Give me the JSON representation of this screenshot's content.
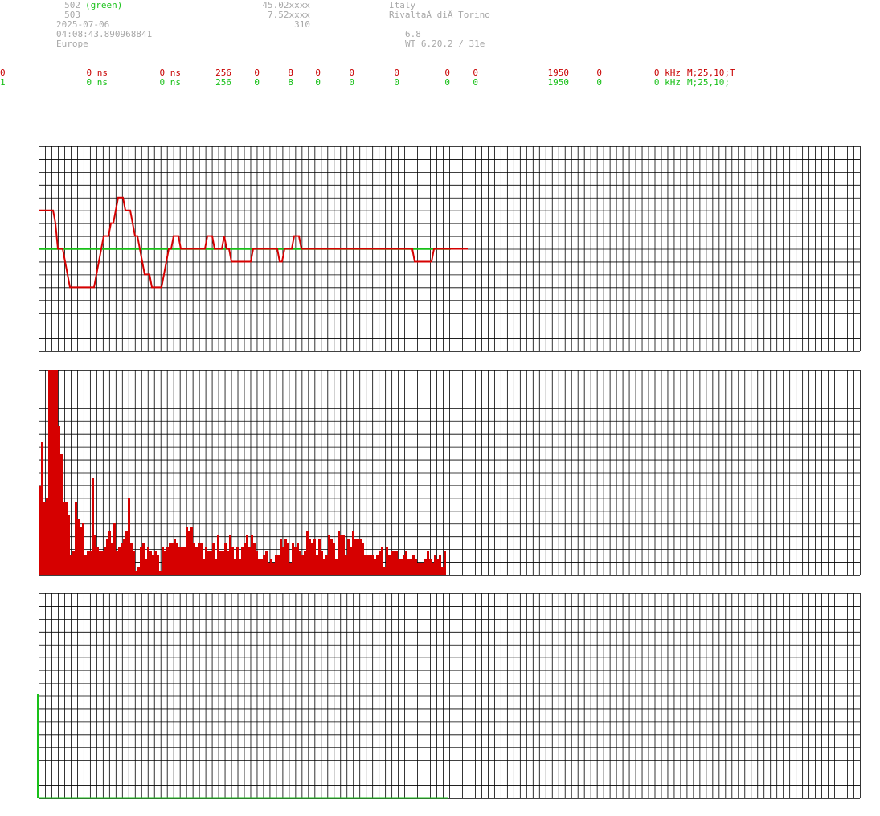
{
  "info": {
    "id1": "502",
    "id1_note": "(green)",
    "id2": "503",
    "date": "2025-07-06",
    "time": "04:08:43.890968841",
    "region": "Europe",
    "lat": "45.02xxxx",
    "lon": "7.52xxxx",
    "alt": "310",
    "country": "Italy",
    "city": "RivaltaÂ diÂ Torino",
    "val1": "6.8",
    "version": "WT 6.20.2 / 31e"
  },
  "rows": [
    {
      "ch": "0",
      "a": "0 ns",
      "b": "0 ns",
      "c": "256",
      "d": "0",
      "e": "8",
      "f": "0",
      "g": "0",
      "h": "0",
      "i": "0",
      "j": "0",
      "k": "1950",
      "l": "0",
      "m": "0 kHz",
      "n": "M;25,10;T",
      "color": "#c80000"
    },
    {
      "ch": "1",
      "a": "0 ns",
      "b": "0 ns",
      "c": "256",
      "d": "0",
      "e": "8",
      "f": "0",
      "g": "0",
      "h": "0",
      "i": "0",
      "j": "0",
      "k": "1950",
      "l": "0",
      "m": "0 kHz",
      "n": "M;25,10;",
      "color": "#18c018"
    }
  ],
  "colors": {
    "red": "#d60000",
    "green": "#18c018",
    "grid": "#000000"
  },
  "chart_data": [
    {
      "type": "line",
      "series": [
        {
          "color": "#d60000",
          "values": [
            3,
            3,
            3,
            3,
            3,
            3,
            3,
            2,
            0,
            0,
            0,
            -1,
            -2,
            -3,
            -3,
            -3,
            -3,
            -3,
            -3,
            -3,
            -3,
            -3,
            -3,
            -3,
            -2,
            -1,
            0,
            1,
            1,
            1,
            2,
            2,
            3,
            4,
            4,
            4,
            3,
            3,
            3,
            2,
            1,
            1,
            0,
            -1,
            -2,
            -2,
            -2,
            -3,
            -3,
            -3,
            -3,
            -3,
            -2,
            -1,
            0,
            0,
            1,
            1,
            1,
            0,
            0,
            0,
            0,
            0,
            0,
            0,
            0,
            0,
            0,
            0,
            1,
            1,
            1,
            0,
            0,
            0,
            0,
            1,
            0,
            0,
            -1,
            -1,
            -1,
            -1,
            -1,
            -1,
            -1,
            -1,
            -1,
            0,
            0,
            0,
            0,
            0,
            0,
            0,
            0,
            0,
            0,
            0,
            -1,
            -1,
            0,
            0,
            0,
            0,
            1,
            1,
            1,
            0,
            0,
            0,
            0,
            0,
            0,
            0,
            0,
            0,
            0,
            0,
            0,
            0,
            0,
            0,
            0,
            0,
            0,
            0,
            0,
            0,
            0,
            0,
            0,
            0,
            0,
            0,
            0,
            0,
            0,
            0,
            0,
            0,
            0,
            0,
            0,
            0,
            0,
            0,
            0,
            0,
            0,
            0,
            0,
            0,
            0,
            0,
            -1,
            -1,
            -1,
            -1,
            -1,
            -1,
            -1,
            -1,
            0,
            0,
            0,
            0,
            0,
            0,
            0,
            0,
            0,
            0,
            0,
            0,
            0,
            0,
            0
          ]
        },
        {
          "color": "#18c018",
          "values": [
            0,
            0,
            0,
            0,
            0,
            0,
            0,
            0,
            0,
            0,
            0,
            0,
            0,
            0,
            0,
            0,
            0,
            0,
            0,
            0,
            0,
            0,
            0,
            0,
            0,
            0,
            0,
            0,
            0,
            0,
            0,
            0,
            0,
            0,
            0,
            0,
            0,
            0,
            0,
            0,
            0,
            0,
            0,
            0,
            0,
            0,
            0,
            0,
            0,
            0,
            0,
            0,
            0,
            0,
            0,
            0,
            0,
            0,
            0,
            0,
            0,
            0,
            0,
            0,
            0,
            0,
            0,
            0,
            0,
            0,
            0,
            0,
            0,
            0,
            0,
            0,
            0,
            0,
            0,
            0,
            0,
            0,
            0,
            0,
            0,
            0,
            0,
            0,
            0,
            0,
            0,
            0,
            0,
            0,
            0,
            0,
            0,
            0,
            0,
            0,
            0,
            0,
            0,
            0,
            0,
            0,
            0,
            0,
            0,
            0,
            0,
            0,
            0,
            0,
            0,
            0,
            0,
            0,
            0,
            0,
            0,
            0,
            0,
            0,
            0,
            0,
            0,
            0,
            0,
            0,
            0,
            0,
            0,
            0,
            0,
            0,
            0,
            0,
            0,
            0,
            0,
            0,
            0,
            0,
            0,
            0,
            0,
            0,
            0,
            0,
            0,
            0,
            0,
            0,
            0,
            0,
            0,
            0,
            0,
            0,
            0,
            0,
            0,
            0,
            0,
            0,
            0,
            0,
            0,
            0,
            0,
            0
          ]
        }
      ],
      "ylim": [
        -8,
        8
      ],
      "grid": true
    },
    {
      "type": "bar",
      "series": [
        {
          "color": "#d60000",
          "values": [
            110,
            165,
            90,
            95,
            255,
            255,
            255,
            255,
            185,
            150,
            90,
            90,
            75,
            25,
            30,
            90,
            70,
            60,
            65,
            25,
            30,
            30,
            120,
            50,
            35,
            30,
            30,
            35,
            45,
            55,
            40,
            65,
            30,
            35,
            40,
            45,
            55,
            95,
            40,
            30,
            5,
            10,
            35,
            40,
            20,
            35,
            30,
            25,
            30,
            25,
            5,
            35,
            30,
            35,
            40,
            40,
            45,
            40,
            35,
            35,
            35,
            60,
            55,
            60,
            40,
            35,
            40,
            40,
            20,
            35,
            30,
            30,
            40,
            20,
            50,
            30,
            30,
            40,
            30,
            50,
            35,
            20,
            35,
            20,
            35,
            40,
            50,
            35,
            50,
            40,
            30,
            20,
            20,
            25,
            30,
            15,
            20,
            15,
            25,
            25,
            45,
            35,
            45,
            40,
            15,
            40,
            35,
            40,
            30,
            25,
            30,
            55,
            45,
            40,
            45,
            25,
            45,
            30,
            20,
            25,
            50,
            45,
            40,
            20,
            55,
            50,
            50,
            25,
            45,
            35,
            55,
            45,
            45,
            45,
            40,
            25,
            25,
            25,
            25,
            20,
            25,
            30,
            35,
            10,
            35,
            25,
            30,
            30,
            30,
            20,
            20,
            25,
            30,
            20,
            20,
            25,
            20,
            15,
            15,
            15,
            20,
            30,
            20,
            15,
            25,
            20,
            25,
            10,
            30
          ]
        }
      ],
      "ylim": [
        0,
        255
      ],
      "grid": true
    },
    {
      "type": "line",
      "series": [
        {
          "color": "#18c018",
          "values": [
            0
          ]
        }
      ],
      "ylim": [
        0,
        255
      ],
      "grid": true
    }
  ]
}
